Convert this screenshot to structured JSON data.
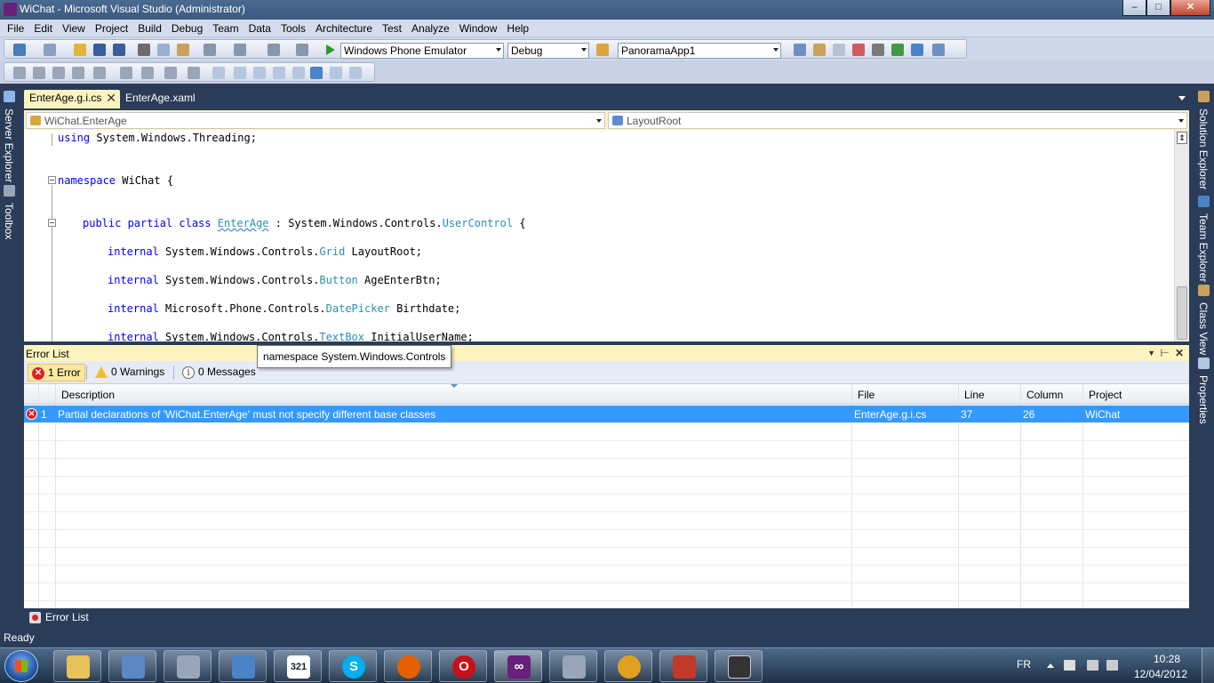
{
  "window": {
    "title": "WiChat - Microsoft Visual Studio (Administrator)",
    "controls": [
      "minimize",
      "maximize",
      "close"
    ]
  },
  "menu": [
    "File",
    "Edit",
    "View",
    "Project",
    "Build",
    "Debug",
    "Team",
    "Data",
    "Tools",
    "Architecture",
    "Test",
    "Analyze",
    "Window",
    "Help"
  ],
  "toolbar": {
    "target": "Windows Phone Emulator",
    "configuration": "Debug",
    "find_combo": "PanoramaApp1"
  },
  "left_tabs": [
    "Server Explorer",
    "Toolbox"
  ],
  "right_tabs": [
    "Solution Explorer",
    "Team Explorer",
    "Class View",
    "Properties"
  ],
  "doc_tabs": [
    {
      "label": "EnterAge.g.i.cs",
      "active": true
    },
    {
      "label": "EnterAge.xaml",
      "active": false
    }
  ],
  "navbar": {
    "type_combo": "WiChat.EnterAge",
    "member_combo": "LayoutRoot"
  },
  "code": {
    "line1": [
      "using",
      " System.Windows.Threading;"
    ],
    "line2": [
      "namespace",
      " WiChat {"
    ],
    "line3": [
      "public partial class",
      " ",
      "EnterAge",
      " : System.Windows.Controls.",
      "UserControl",
      " {"
    ],
    "line4": [
      "internal",
      " System.Windows.Controls.",
      "Grid",
      " LayoutRoot;"
    ],
    "line5": [
      "internal",
      " System.Windows.Controls.",
      "Button",
      " AgeEnterBtn;"
    ],
    "line6": [
      "internal",
      " Microsoft.Phone.Controls.",
      "DatePicker",
      " Birthdate;"
    ],
    "line7": [
      "internal",
      " System.Windows.Controls.",
      "TextBox",
      " InitialUserName;"
    ]
  },
  "tooltip": "namespace System.Windows.Controls",
  "error_list": {
    "title": "Error List",
    "filters": {
      "errors": "1 Error",
      "warnings": "0 Warnings",
      "messages": "0 Messages"
    },
    "columns": [
      "Description",
      "File",
      "Line",
      "Column",
      "Project"
    ],
    "rows": [
      {
        "index": "1",
        "description": "Partial declarations of 'WiChat.EnterAge' must not specify different base classes",
        "file": "EnterAge.g.i.cs",
        "line": "37",
        "column": "26",
        "project": "WiChat"
      }
    ]
  },
  "bottom_tab": "Error List",
  "status": "Ready",
  "taskbar": {
    "apps": [
      "explorer",
      "remote-desktop",
      "device-manager",
      "windows-update",
      "calendar-321",
      "skype",
      "firefox",
      "opera",
      "visual-studio",
      "zoom-tool",
      "settings",
      "3d-builder",
      "phone-emulator"
    ],
    "calendar_text": "321",
    "language": "FR",
    "time": "10:28",
    "date": "12/04/2012"
  },
  "colors": {
    "chrome": "#2b3c59",
    "active_tab": "#fdf4bf",
    "selection": "#3399ff",
    "keyword": "#0000ff",
    "type": "#2b91af"
  }
}
